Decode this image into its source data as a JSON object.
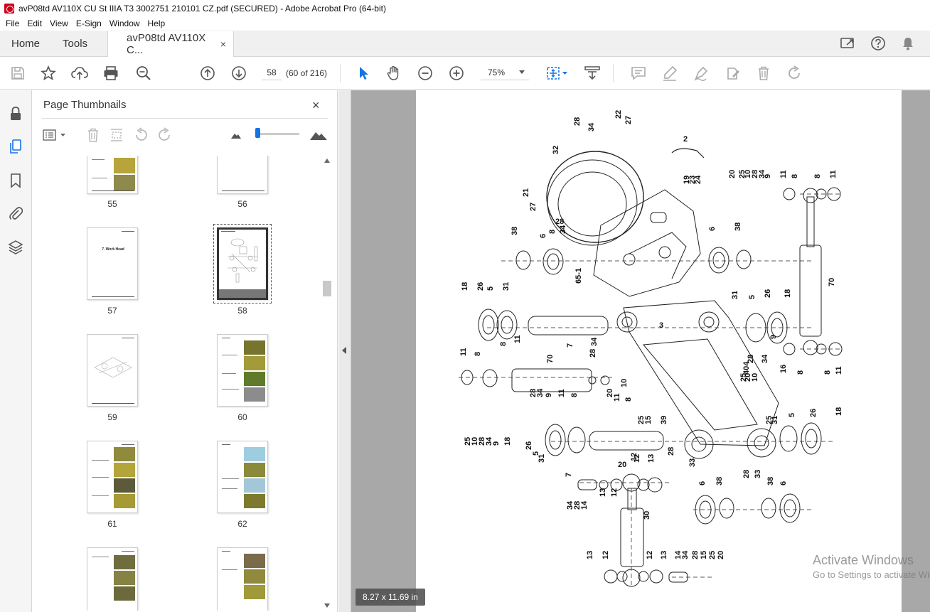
{
  "window": {
    "title": "avP08td AV110X CU St IIIA T3 3002751 210101 CZ.pdf (SECURED) - Adobe Acrobat Pro (64-bit)"
  },
  "menu": [
    "File",
    "Edit",
    "View",
    "E-Sign",
    "Window",
    "Help"
  ],
  "tabs": {
    "home": "Home",
    "tools": "Tools",
    "doc": "avP08td AV110X C...",
    "close": "×"
  },
  "toolbar": {
    "page_value": "58",
    "page_of": "(60 of 216)",
    "zoom": "75%"
  },
  "panel": {
    "title": "Page Thumbnails",
    "close": "×",
    "thumbnails": [
      {
        "label": "55"
      },
      {
        "label": "56"
      },
      {
        "label": "57",
        "heading": "7. Work Head"
      },
      {
        "label": "58",
        "selected": true
      },
      {
        "label": "59"
      },
      {
        "label": "60"
      },
      {
        "label": "61"
      },
      {
        "label": "62"
      },
      {
        "label": ""
      },
      {
        "label": ""
      }
    ]
  },
  "document": {
    "page_size": "8.27 x 11.69 in",
    "labels": [
      "28",
      "34",
      "22",
      "27",
      "32",
      "2",
      "21",
      "27",
      "19",
      "23",
      "24",
      "20",
      "25",
      "10",
      "28",
      "34",
      "9",
      "11",
      "8",
      "8",
      "11",
      "8",
      "34",
      "28",
      "38",
      "6",
      "6",
      "38",
      "65-1",
      "18",
      "26",
      "5",
      "31",
      "7",
      "3",
      "31",
      "5",
      "26",
      "18",
      "70",
      "11",
      "8",
      "28",
      "34",
      "8",
      "11",
      "70",
      "10",
      "11",
      "8",
      "20",
      "25",
      "10",
      "404",
      "28",
      "34",
      "16",
      "9",
      "8",
      "8",
      "11",
      "28",
      "34",
      "9",
      "11",
      "8",
      "20",
      "25",
      "10",
      "28",
      "34",
      "9",
      "18",
      "26",
      "5",
      "31",
      "7",
      "20",
      "25",
      "15",
      "39",
      "25",
      "31",
      "5",
      "26",
      "18",
      "28",
      "33",
      "28",
      "33",
      "12",
      "13",
      "34",
      "28",
      "14",
      "13",
      "12",
      "12",
      "6",
      "38",
      "38",
      "6",
      "30",
      "13",
      "12",
      "12",
      "13",
      "14",
      "34",
      "28",
      "15",
      "25",
      "20"
    ]
  },
  "watermark": {
    "title": "Activate Windows",
    "subtitle": "Go to Settings to activate Windows."
  },
  "colors": {
    "accent": "#1473e6",
    "canvas": "#a8a8a8",
    "acrobat_red": "#d0021b"
  }
}
